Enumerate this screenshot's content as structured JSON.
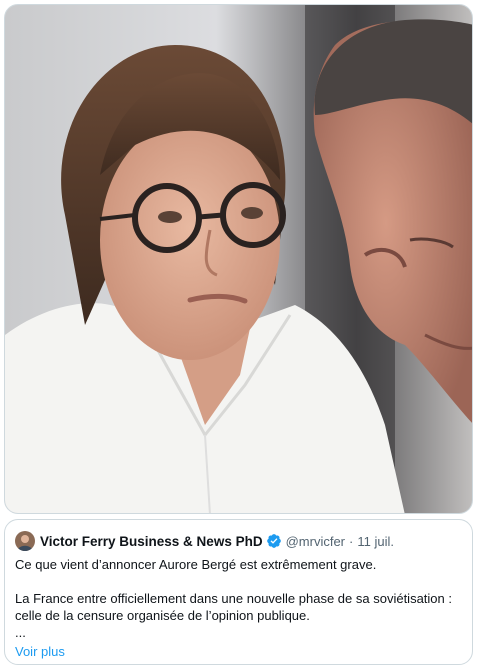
{
  "media": {
    "description_icon": "photo"
  },
  "quoted_tweet": {
    "author_name": "Victor Ferry Business & News PhD",
    "verified_icon": "verified-badge-icon",
    "handle": "@mrvicfer",
    "separator": "·",
    "date": "11 juil.",
    "paragraph_1": "Ce que vient d’annoncer Aurore Bergé est extrêmement grave.",
    "paragraph_2_line_1": "La France entre officiellement dans une nouvelle phase de sa soviétisation :",
    "paragraph_2_line_2": "celle de la censure organisée de l’opinion publique.",
    "ellipsis": "...",
    "show_more": "Voir plus"
  },
  "colors": {
    "link": "#1d9bf0",
    "verified": "#1d9bf0",
    "secondary_text": "#536471",
    "border": "#cfd9de"
  }
}
